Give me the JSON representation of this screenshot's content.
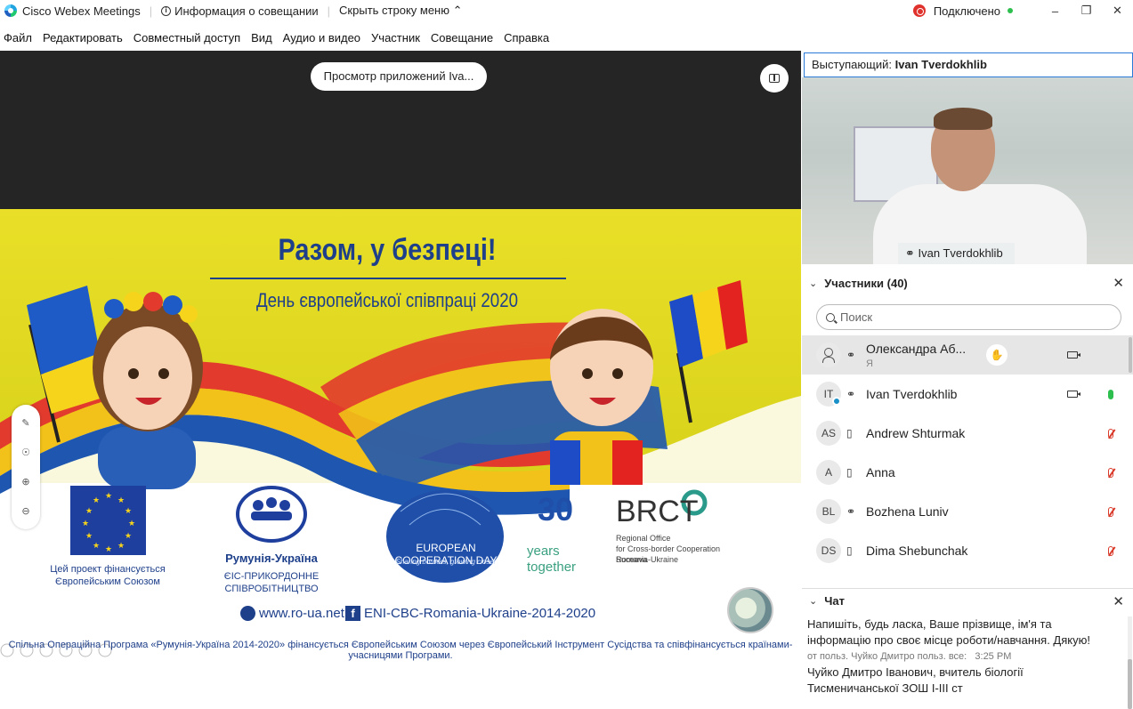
{
  "titlebar": {
    "app_name": "Cisco Webex Meetings",
    "meeting_info": "Информация о совещании",
    "hide_menu": "Скрыть строку меню",
    "status": "Подключено",
    "colors": {
      "connected": "#2dbf4e",
      "record": "#e0322c"
    }
  },
  "menu": [
    "Файл",
    "Редактировать",
    "Совместный доступ",
    "Вид",
    "Аудио и видео",
    "Участник",
    "Совещание",
    "Справка"
  ],
  "stage": {
    "share_label": "Просмотр приложений Iva...",
    "slide": {
      "title": "Разом, у безпеці!",
      "subtitle": "День європейської співпраці 2020",
      "eu_caption": "Цей проект фінансується Європейським Союзом",
      "ro_ua_title": "Румунія-Україна",
      "ro_ua_caption": "ЄІС-ПРИКОРДОННЕ СПІВРОБІТНИЦТВО",
      "ecd_title": "EUROPEAN COOPERATION DAY",
      "ecd_tagline": "Sharing borders, growing closer",
      "thirty": "30",
      "years": "years",
      "together": "together",
      "brct": "BRCT",
      "brct_caption_1": "Regional Office",
      "brct_caption_2": "for Cross-border Cooperation Suceava",
      "brct_caption_3": "Romania-Ukraine",
      "website": "www.ro-ua.net",
      "facebook": "ENI-CBC-Romania-Ukraine-2014-2020",
      "footer": "Спільна Операційна Програма «Румунія-Україна 2014-2020» фінансується Європейським Союзом через Європейський Інструмент Сусідства та співфінансується країнами-учасницями Програми."
    }
  },
  "speaker": {
    "label": "Выступающий:",
    "name": "Ivan Tverdokhlib"
  },
  "video_tag": "Ivan Tverdokhlib",
  "participants": {
    "title": "Участники (40)",
    "search_placeholder": "Поиск",
    "list": [
      {
        "initials": "",
        "name": "Олександра Аб...",
        "sub": "Я",
        "device": "headset",
        "mic": "none",
        "video": true,
        "hand": true
      },
      {
        "initials": "IT",
        "name": "Ivan Tverdokhlib",
        "sub": "",
        "device": "headset",
        "mic": "on",
        "video": true,
        "hand": false
      },
      {
        "initials": "AS",
        "name": "Andrew Shturmak",
        "sub": "",
        "device": "phone",
        "mic": "off",
        "video": false,
        "hand": false
      },
      {
        "initials": "A",
        "name": "Anna",
        "sub": "",
        "device": "phone",
        "mic": "off",
        "video": false,
        "hand": false
      },
      {
        "initials": "BL",
        "name": "Bozhena Luniv",
        "sub": "",
        "device": "headset",
        "mic": "off",
        "video": false,
        "hand": false
      },
      {
        "initials": "DS",
        "name": "Dima Shebunchak",
        "sub": "",
        "device": "phone",
        "mic": "off",
        "video": false,
        "hand": false
      }
    ]
  },
  "chat": {
    "title": "Чат",
    "partial_line": "...ть, будь ласка, Ваше прізвище, ім'я та",
    "line2": "Напишіть, будь ласка, Ваше прізвище, ім'я та",
    "line3": "інформацію про своє місце роботи/навчання. Дякую!",
    "meta_from": "от польз. Чуйко Дмитро польз. все:",
    "meta_time": "3:25 PM",
    "msg_line1": "Чуйко Дмитро Іванович, вчитель біології",
    "msg_line2": "Тисменичанської ЗОШ І-ІІІ ст"
  }
}
